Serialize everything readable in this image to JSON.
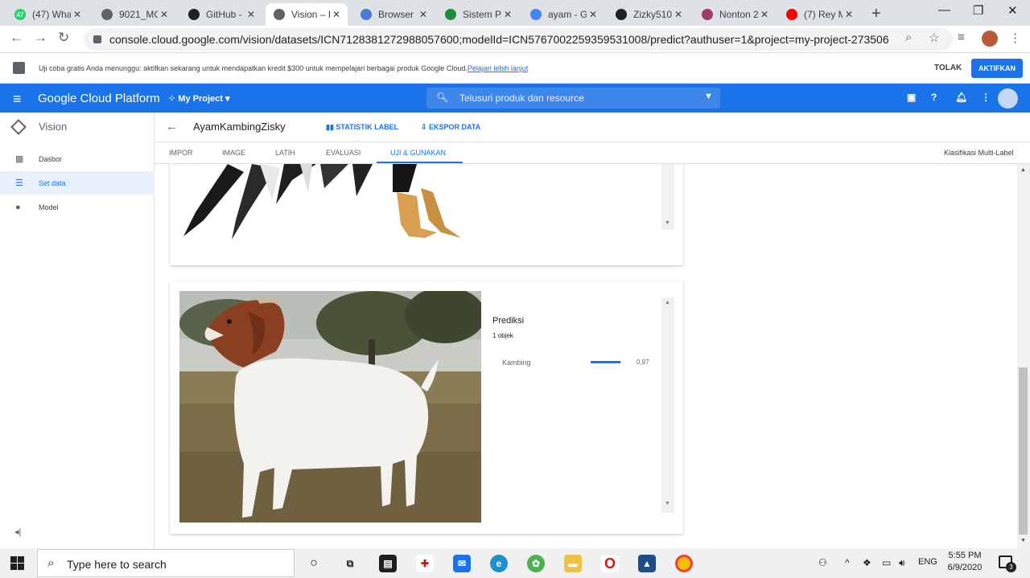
{
  "browser": {
    "tabs": [
      {
        "label": "(47) Wha",
        "favicon": "whatsapp-icon",
        "color": "#25d366",
        "badge": "47"
      },
      {
        "label": "9021_MC",
        "favicon": "globe-icon",
        "color": "#5f6368",
        "badge": ""
      },
      {
        "label": "GitHub -",
        "favicon": "github-icon",
        "color": "#202124",
        "badge": ""
      },
      {
        "label": "Vision – I",
        "favicon": "vision-icon",
        "color": "#5f6368",
        "badge": ""
      },
      {
        "label": "Browser",
        "favicon": "browser-icon",
        "color": "#4a7bd0",
        "badge": ""
      },
      {
        "label": "Sistem Pe",
        "favicon": "classroom-icon",
        "color": "#1e8e3e",
        "badge": ""
      },
      {
        "label": "ayam - G",
        "favicon": "google-icon",
        "color": "#4285f4",
        "badge": ""
      },
      {
        "label": "Zizky510",
        "favicon": "github-icon",
        "color": "#202124",
        "badge": ""
      },
      {
        "label": "Nonton 2",
        "favicon": "site-icon",
        "color": "#9c3a6b",
        "badge": ""
      },
      {
        "label": "(7) Rey M",
        "favicon": "youtube-icon",
        "color": "#ff0000",
        "badge": ""
      }
    ],
    "active_tab": 3,
    "url": "console.cloud.google.com/vision/datasets/ICN7128381272988057600;modelId=ICN5767002259359531008/predict?authuser=1&project=my-project-273506"
  },
  "promo": {
    "text": "Uji coba gratis Anda menunggu: aktifkan sekarang untuk mendapatkan kredit $300 untuk mempelajari berbagai produk Google Cloud.",
    "link": "Pelajari lebih lanjut",
    "dismiss": "TOLAK",
    "activate": "AKTIFKAN"
  },
  "header": {
    "title": "Google Cloud Platform",
    "project": "My Project",
    "search_placeholder": "Telusuri produk dan resource"
  },
  "sidebar": {
    "title": "Vision",
    "items": [
      {
        "label": "Dasbor",
        "icon": "dashboard-icon",
        "active": false
      },
      {
        "label": "Set data",
        "icon": "list-icon",
        "active": true
      },
      {
        "label": "Model",
        "icon": "bulb-icon",
        "active": false
      }
    ]
  },
  "subheader": {
    "dataset_name": "AyamKambingZisky",
    "label_stats": "STATISTIK LABEL",
    "export": "EKSPOR DATA"
  },
  "tabs": {
    "items": [
      "IMPOR",
      "IMAGE",
      "LATIH",
      "EVALUASI",
      "UJI & GUNAKAN"
    ],
    "selected": 4,
    "classification": "Klasifikasi Multi-Label"
  },
  "prediction": {
    "title": "Prediksi",
    "count": "1 objek",
    "label": "Kambing",
    "score": "0,97",
    "score_value": 0.97
  },
  "taskbar": {
    "search_placeholder": "Type here to search",
    "language": "ENG",
    "time": "5:55 PM",
    "date": "6/9/2020",
    "notifications": "3"
  }
}
